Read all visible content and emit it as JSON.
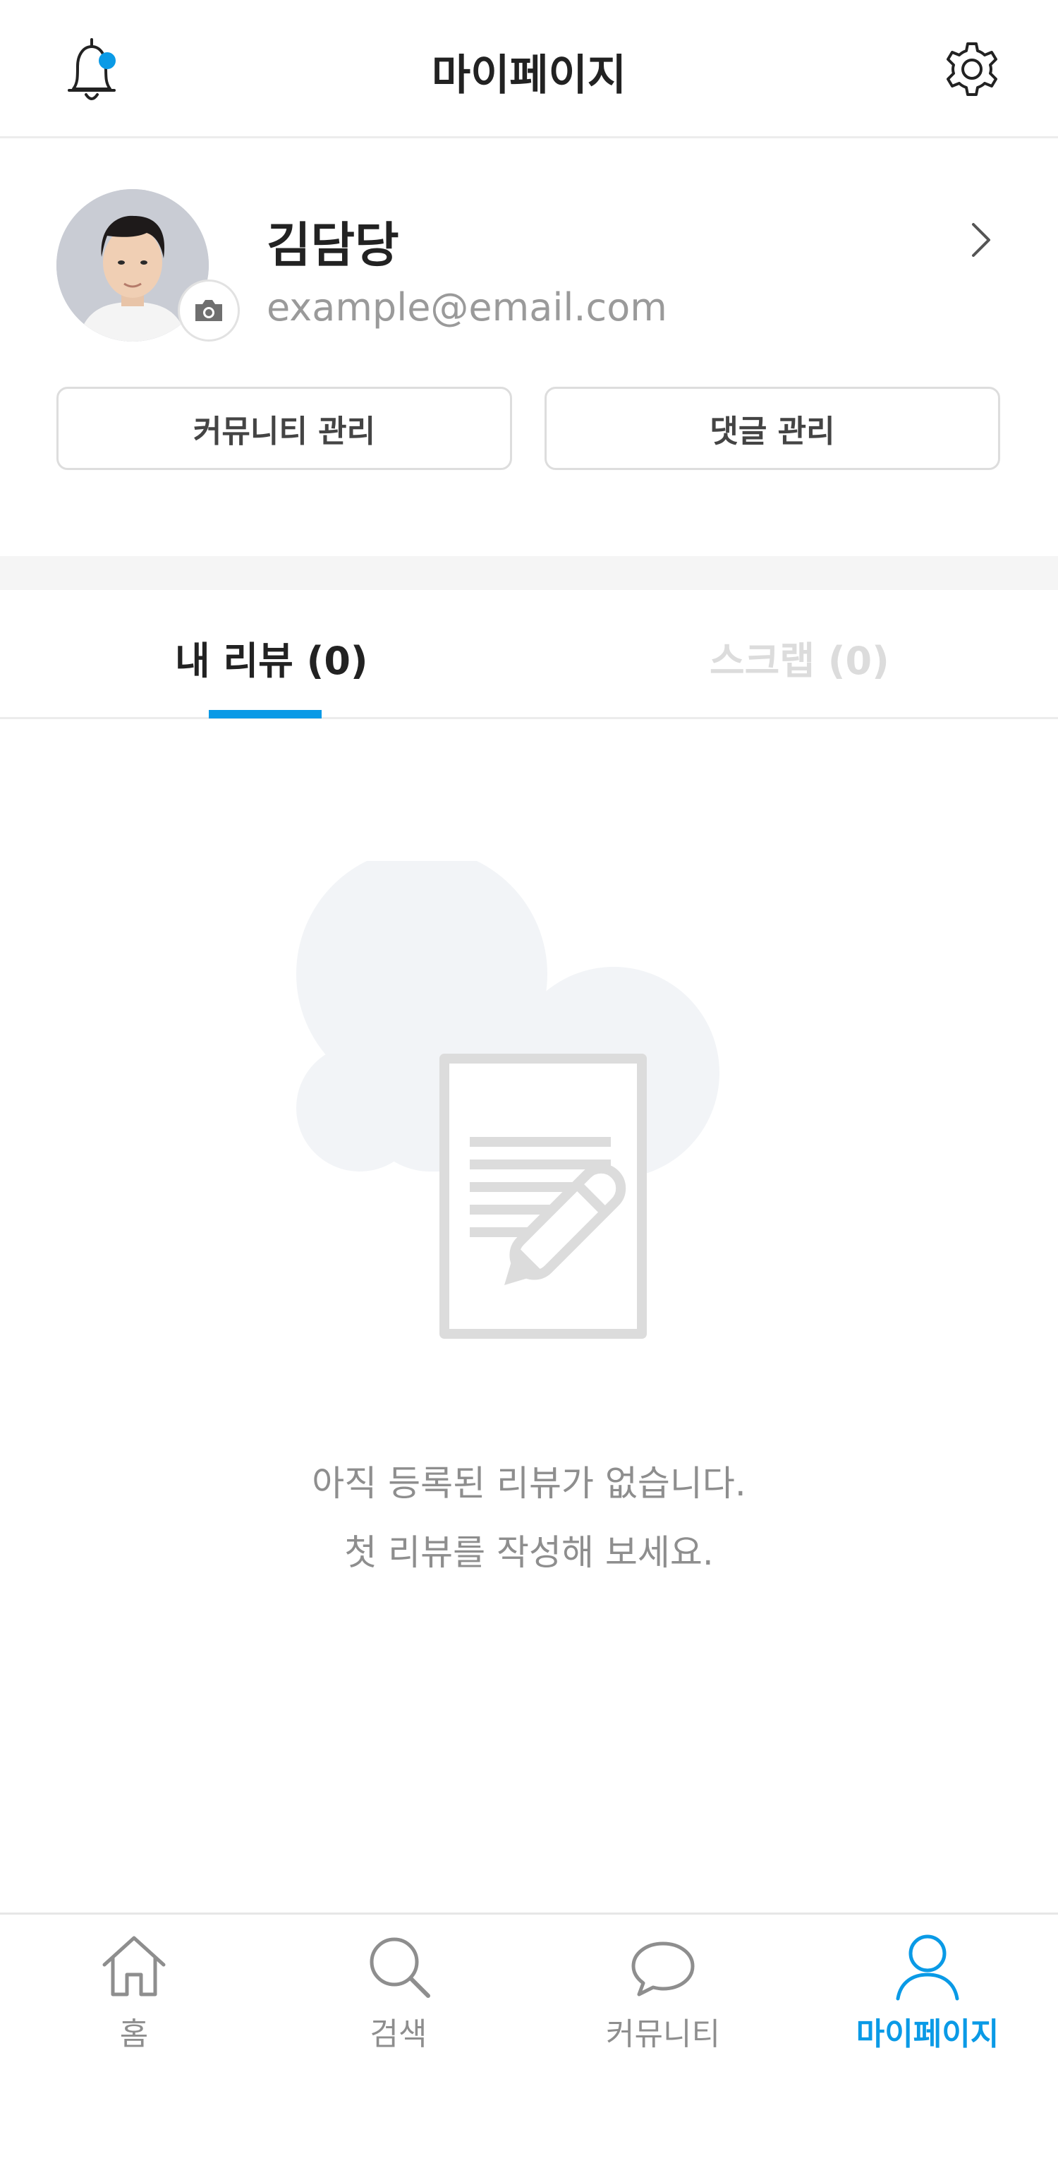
{
  "header": {
    "title": "마이페이지",
    "bell_icon": "bell-icon",
    "settings_icon": "gear-icon",
    "notification_dot_color": "#0a9ae6"
  },
  "profile": {
    "name": "김담당",
    "email": "example@email.com",
    "camera_icon": "camera-icon",
    "chevron_icon": "chevron-right-icon"
  },
  "actions": {
    "community_manage": "커뮤니티 관리",
    "comment_manage": "댓글 관리"
  },
  "tabs": [
    {
      "label": "내 리뷰 (0)",
      "active": true
    },
    {
      "label": "스크랩 (0)",
      "active": false
    }
  ],
  "empty_state": {
    "line1": "아직 등록된 리뷰가 없습니다.",
    "line2": "첫 리뷰를 작성해 보세요.",
    "icon": "document-pencil-icon"
  },
  "bottom_nav": [
    {
      "label": "홈",
      "icon": "home-icon",
      "active": false
    },
    {
      "label": "검색",
      "icon": "search-icon",
      "active": false
    },
    {
      "label": "커뮤니티",
      "icon": "chat-bubble-icon",
      "active": false
    },
    {
      "label": "마이페이지",
      "icon": "person-icon",
      "active": true
    }
  ],
  "colors": {
    "accent": "#0a9ae6",
    "text_primary": "#222222",
    "text_muted": "#8e8e8e",
    "tab_inactive": "#dcdcdc"
  }
}
